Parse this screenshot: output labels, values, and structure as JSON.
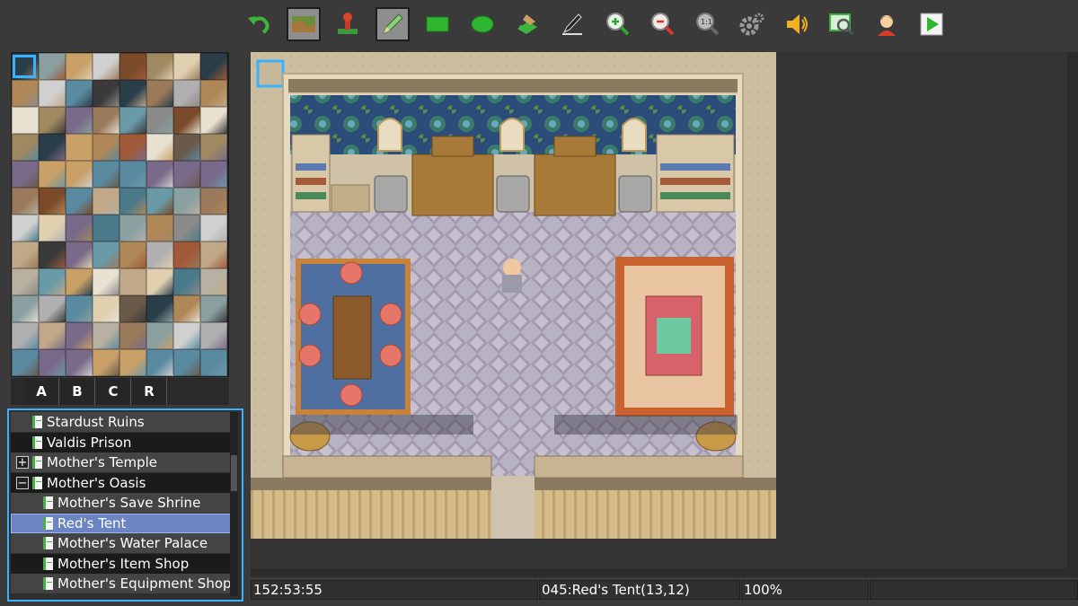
{
  "toolbar": {
    "buttons": [
      {
        "name": "undo",
        "icon": "undo-icon"
      },
      {
        "name": "map-layer",
        "icon": "map-layer-icon",
        "active": true
      },
      {
        "name": "event-layer",
        "icon": "event-icon"
      },
      {
        "name": "pencil",
        "icon": "pencil-icon",
        "active": true
      },
      {
        "name": "rectangle",
        "icon": "rectangle-icon"
      },
      {
        "name": "ellipse",
        "icon": "ellipse-icon"
      },
      {
        "name": "fill",
        "icon": "fill-icon"
      },
      {
        "name": "shadow-pen",
        "icon": "shadow-pen-icon"
      },
      {
        "name": "zoom-in",
        "icon": "zoom-in-icon"
      },
      {
        "name": "zoom-out",
        "icon": "zoom-out-icon"
      },
      {
        "name": "actual-size",
        "icon": "actual-size-icon",
        "text": "1:1"
      },
      {
        "name": "database",
        "icon": "gear-icon"
      },
      {
        "name": "sound-test",
        "icon": "speaker-icon"
      },
      {
        "name": "event-search",
        "icon": "search-icon"
      },
      {
        "name": "character-generator",
        "icon": "character-icon"
      },
      {
        "name": "playtest",
        "icon": "play-icon"
      }
    ]
  },
  "tileset_tabs": [
    "A",
    "B",
    "C",
    "R"
  ],
  "map_tree": {
    "items": [
      {
        "label": "Stardust Ruins",
        "level": 0,
        "expander": "",
        "style": "mid"
      },
      {
        "label": "Valdis Prison",
        "level": 0,
        "expander": "",
        "style": "dark"
      },
      {
        "label": "Mother's Temple",
        "level": 0,
        "expander": "+",
        "style": "mid"
      },
      {
        "label": "Mother's Oasis",
        "level": 0,
        "expander": "−",
        "style": "dark"
      },
      {
        "label": "Mother's Save Shrine",
        "level": 1,
        "expander": "",
        "style": "mid"
      },
      {
        "label": "Red's Tent",
        "level": 1,
        "expander": "",
        "style": "sel"
      },
      {
        "label": "Mother's Water Palace",
        "level": 1,
        "expander": "",
        "style": "mid"
      },
      {
        "label": "Mother's Item Shop",
        "level": 1,
        "expander": "",
        "style": "dark"
      },
      {
        "label": "Mother's Equipment Shop",
        "level": 1,
        "expander": "",
        "style": "mid"
      }
    ]
  },
  "status": {
    "playtime": "152:53:55",
    "map_info": "045:Red's Tent(13,12)",
    "zoom": "100%"
  },
  "colors": {
    "selection_border": "#38b2ff",
    "tree_selected": "#6b84c4"
  }
}
